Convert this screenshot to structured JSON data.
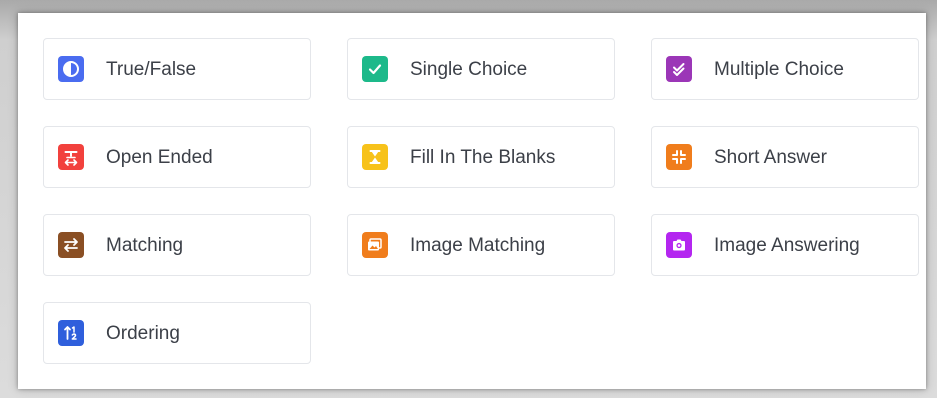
{
  "question_types": [
    {
      "label": "True/False",
      "icon": "contrast-circle-icon",
      "color": "#4a6cf0"
    },
    {
      "label": "Single Choice",
      "icon": "check-icon",
      "color": "#1db98a"
    },
    {
      "label": "Multiple Choice",
      "icon": "double-check-icon",
      "color": "#9b36b7"
    },
    {
      "label": "Open Ended",
      "icon": "text-edit-icon",
      "color": "#f2413d"
    },
    {
      "label": "Fill In The Blanks",
      "icon": "hourglass-icon",
      "color": "#f7c21a"
    },
    {
      "label": "Short Answer",
      "icon": "compress-icon",
      "color": "#f07d1c"
    },
    {
      "label": "Matching",
      "icon": "swap-arrows-icon",
      "color": "#8a4f24"
    },
    {
      "label": "Image Matching",
      "icon": "image-icon",
      "color": "#f07d1c"
    },
    {
      "label": "Image Answering",
      "icon": "camera-icon",
      "color": "#b426f0"
    },
    {
      "label": "Ordering",
      "icon": "sort-numeric-icon",
      "color": "#2f5fdc"
    }
  ]
}
